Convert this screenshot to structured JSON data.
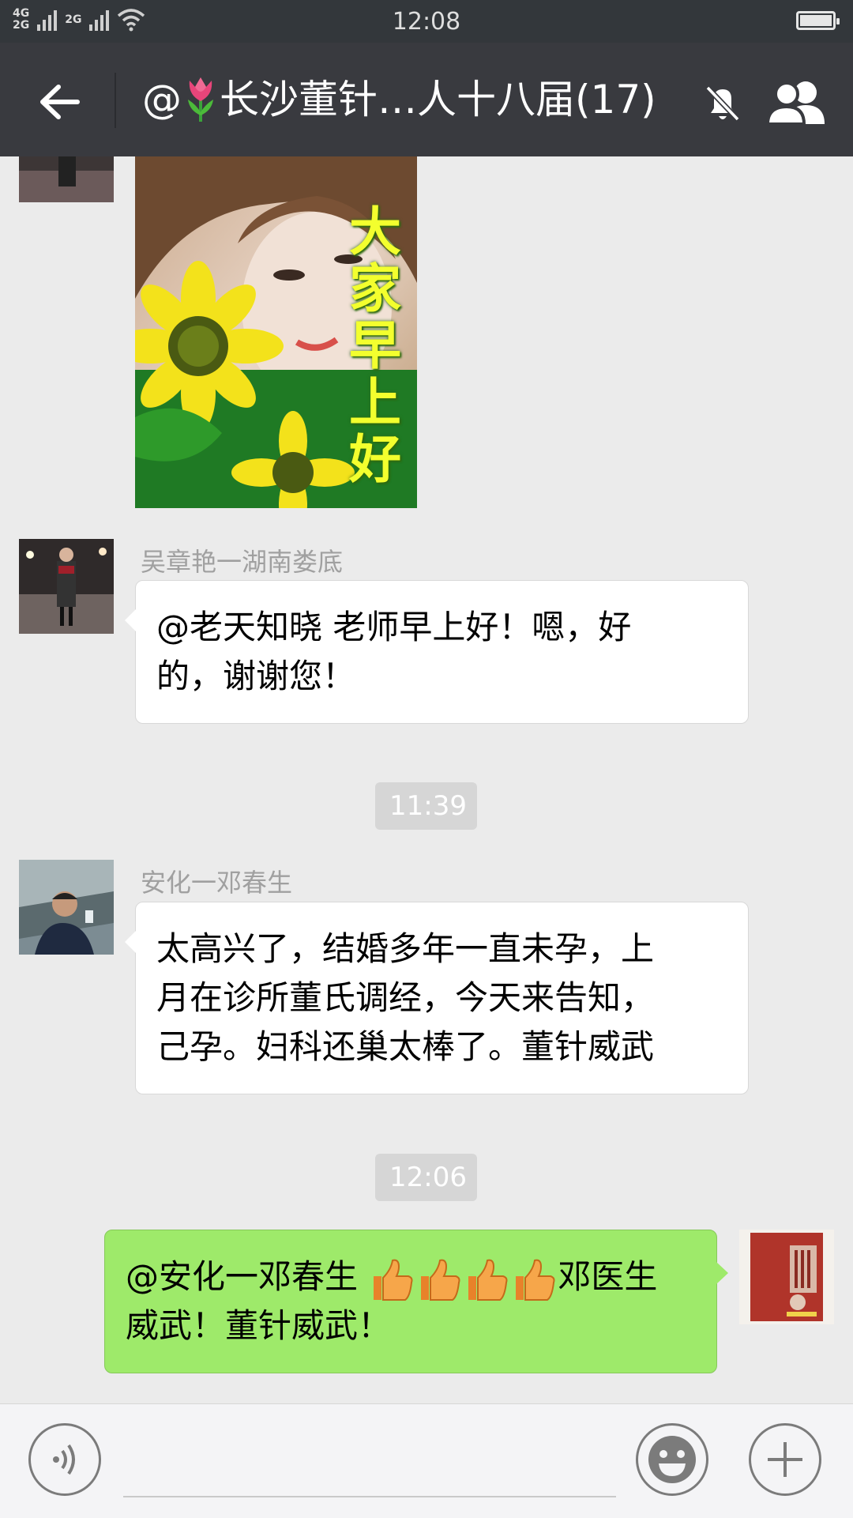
{
  "status_bar": {
    "network_top": "4G",
    "network_bottom": "2G",
    "network2": "2G",
    "time": "12:08",
    "battery_level": 1.0
  },
  "header": {
    "title_prefix": "@",
    "title_icon": "tulip-emoji",
    "title_text": "长沙董针…人十八届(17)",
    "icons": [
      "back-arrow-icon",
      "mute-bell-icon",
      "members-icon"
    ]
  },
  "messages": [
    {
      "type": "image",
      "direction": "in",
      "caption": "大家早上好"
    },
    {
      "type": "text",
      "direction": "in",
      "sender": "吴章艳一湖南娄底",
      "lines": [
        "@老天知晓 老师早上好！嗯，好",
        "的，谢谢您！"
      ]
    },
    {
      "type": "time",
      "text": "11:39"
    },
    {
      "type": "text",
      "direction": "in",
      "sender": "安化一邓春生",
      "lines": [
        "太高兴了，结婚多年一直未孕，上",
        "月在诊所董氏调经，今天来告知，",
        "己孕。妇科还巢太棒了。董针威武"
      ]
    },
    {
      "type": "time",
      "text": "12:06"
    },
    {
      "type": "text",
      "direction": "out",
      "line1_start": "@安化一邓春生 ",
      "emoji": "thumbs-up",
      "emoji_count": 4,
      "line1_end": "邓医生",
      "line2": "威武！董针威武！"
    }
  ],
  "input_bar": {
    "value": "",
    "icons": [
      "voice-icon",
      "emoji-icon",
      "plus-icon"
    ]
  },
  "colors": {
    "status_bar": "#33373b",
    "title_bar": "#393a3f",
    "chat_bg": "#ebebeb",
    "bubble_in": "#ffffff",
    "bubble_out": "#9eea6a",
    "timestamp_bg": "#d6d6d6"
  }
}
